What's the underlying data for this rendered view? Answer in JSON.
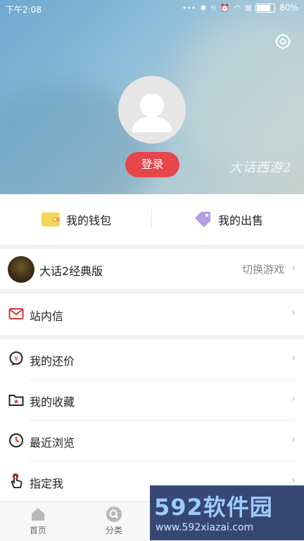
{
  "status_bar": {
    "time": "下午2:08",
    "battery": "80%",
    "battery_level": 0.8
  },
  "header": {
    "login_label": "登录",
    "watermark": "大话西游2"
  },
  "wallet": {
    "wallet_label": "我的钱包",
    "sales_label": "我的出售"
  },
  "game": {
    "name": "大话2经典版",
    "switch_label": "切换游戏"
  },
  "menu": {
    "items": [
      {
        "label": "站内信",
        "icon": "mail-icon"
      },
      {
        "label": "我的还价",
        "icon": "bargain-icon"
      },
      {
        "label": "我的收藏",
        "icon": "folder-star-icon"
      },
      {
        "label": "最近浏览",
        "icon": "clock-icon"
      },
      {
        "label": "指定我",
        "icon": "hand-pointer-icon"
      }
    ],
    "chevron": "›"
  },
  "tabbar": {
    "tabs": [
      {
        "label": "首页",
        "icon": "home-icon"
      },
      {
        "label": "分类",
        "icon": "search-icon"
      }
    ]
  },
  "brand": {
    "name": "592软件园",
    "url": "www.592xiazai.com"
  },
  "colors": {
    "accent": "#e5474b",
    "wallet_yellow": "#f5d45a",
    "tag_purple": "#b69ce8"
  }
}
